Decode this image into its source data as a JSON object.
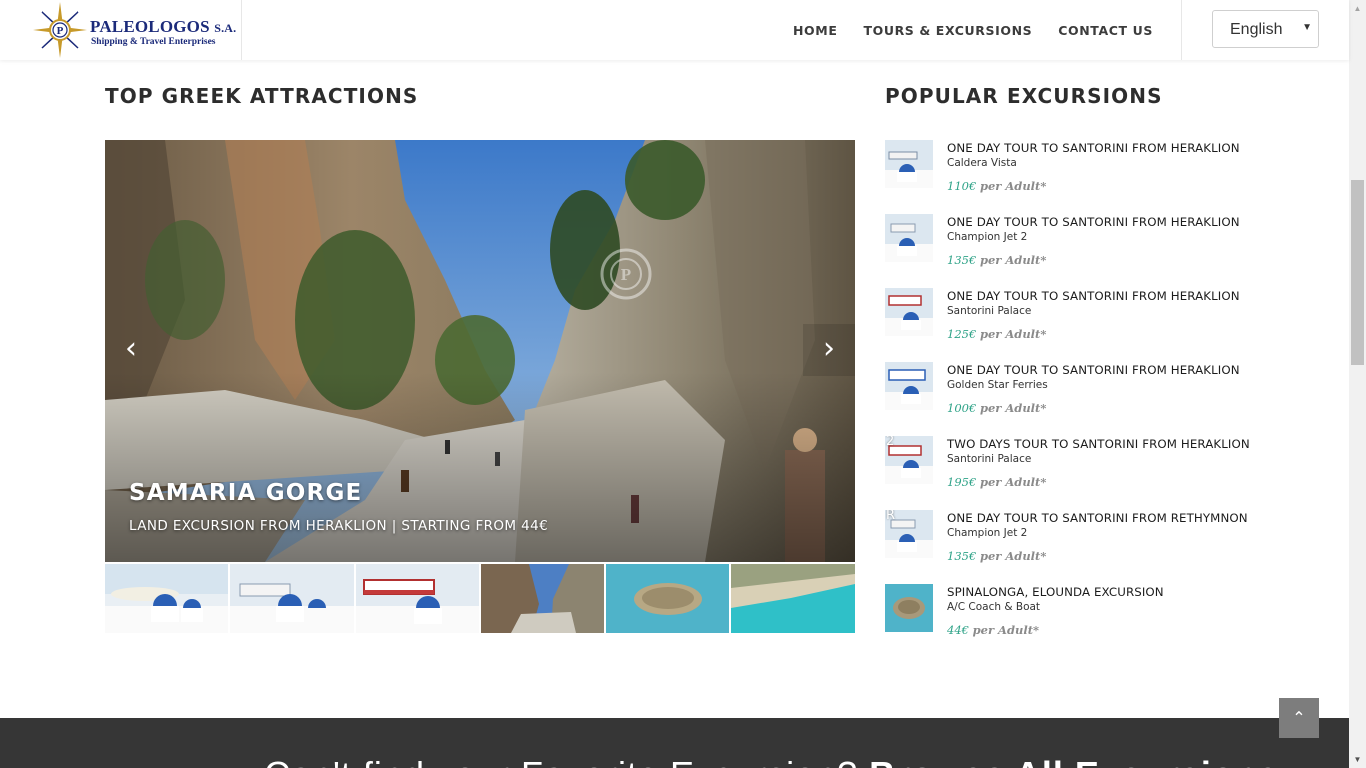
{
  "header": {
    "logo": {
      "name": "PALEOLOGOS",
      "suffix": "S.A.",
      "tagline": "Shipping & Travel Enterprises"
    },
    "nav": [
      {
        "label": "HOME"
      },
      {
        "label": "TOURS & EXCURSIONS"
      },
      {
        "label": "CONTACT US"
      }
    ],
    "language": {
      "selected": "English"
    }
  },
  "attractions": {
    "title": "TOP GREEK ATTRACTIONS",
    "slide": {
      "title": "SAMARIA GORGE",
      "subtitle": "LAND EXCURSION FROM HERAKLION  | STARTING FROM 44€"
    },
    "thumbnails": [
      {
        "name": "santorini-ferry-1"
      },
      {
        "name": "santorini-ferry-2"
      },
      {
        "name": "santorini-ferry-3"
      },
      {
        "name": "samaria-gorge"
      },
      {
        "name": "spinalonga-island"
      },
      {
        "name": "beach-lagoon"
      }
    ]
  },
  "excursions": {
    "title": "POPULAR EXCURSIONS",
    "items": [
      {
        "title": "ONE DAY TOUR TO SANTORINI FROM HERAKLION",
        "subtitle": "Caldera Vista",
        "price": "110€",
        "per": "per Adult*",
        "badge": ""
      },
      {
        "title": "ONE DAY TOUR TO SANTORINI FROM HERAKLION",
        "subtitle": "Champion Jet 2",
        "price": "135€",
        "per": "per Adult*",
        "badge": ""
      },
      {
        "title": "ONE DAY TOUR TO SANTORINI FROM HERAKLION",
        "subtitle": "Santorini Palace",
        "price": "125€",
        "per": "per Adult*",
        "badge": ""
      },
      {
        "title": "ONE DAY TOUR TO SANTORINI FROM HERAKLION",
        "subtitle": "Golden Star Ferries",
        "price": "100€",
        "per": "per Adult*",
        "badge": ""
      },
      {
        "title": "TWO DAYS TOUR TO SANTORINI FROM HERAKLION",
        "subtitle": "Santorini Palace",
        "price": "195€",
        "per": "per Adult*",
        "badge": "2"
      },
      {
        "title": "ONE DAY TOUR TO SANTORINI FROM RETHYMNON",
        "subtitle": "Champion Jet 2",
        "price": "135€",
        "per": "per Adult*",
        "badge": "R"
      },
      {
        "title": "SPINALONGA, ELOUNDA EXCURSION",
        "subtitle": "A/C Coach & Boat",
        "price": "44€",
        "per": "per Adult*",
        "badge": ""
      }
    ]
  },
  "cta": {
    "lead": "Can't find your Favorite Excursion?",
    "action": "Browse All Excursions ›"
  },
  "icons": {
    "prev": "chevron-left-icon",
    "next": "chevron-right-icon",
    "to_top": "chevron-up-icon",
    "select_caret": "caret-down-icon"
  },
  "colors": {
    "price": "#2fa388",
    "footer": "#363636",
    "brand": "#1b2a7a"
  }
}
